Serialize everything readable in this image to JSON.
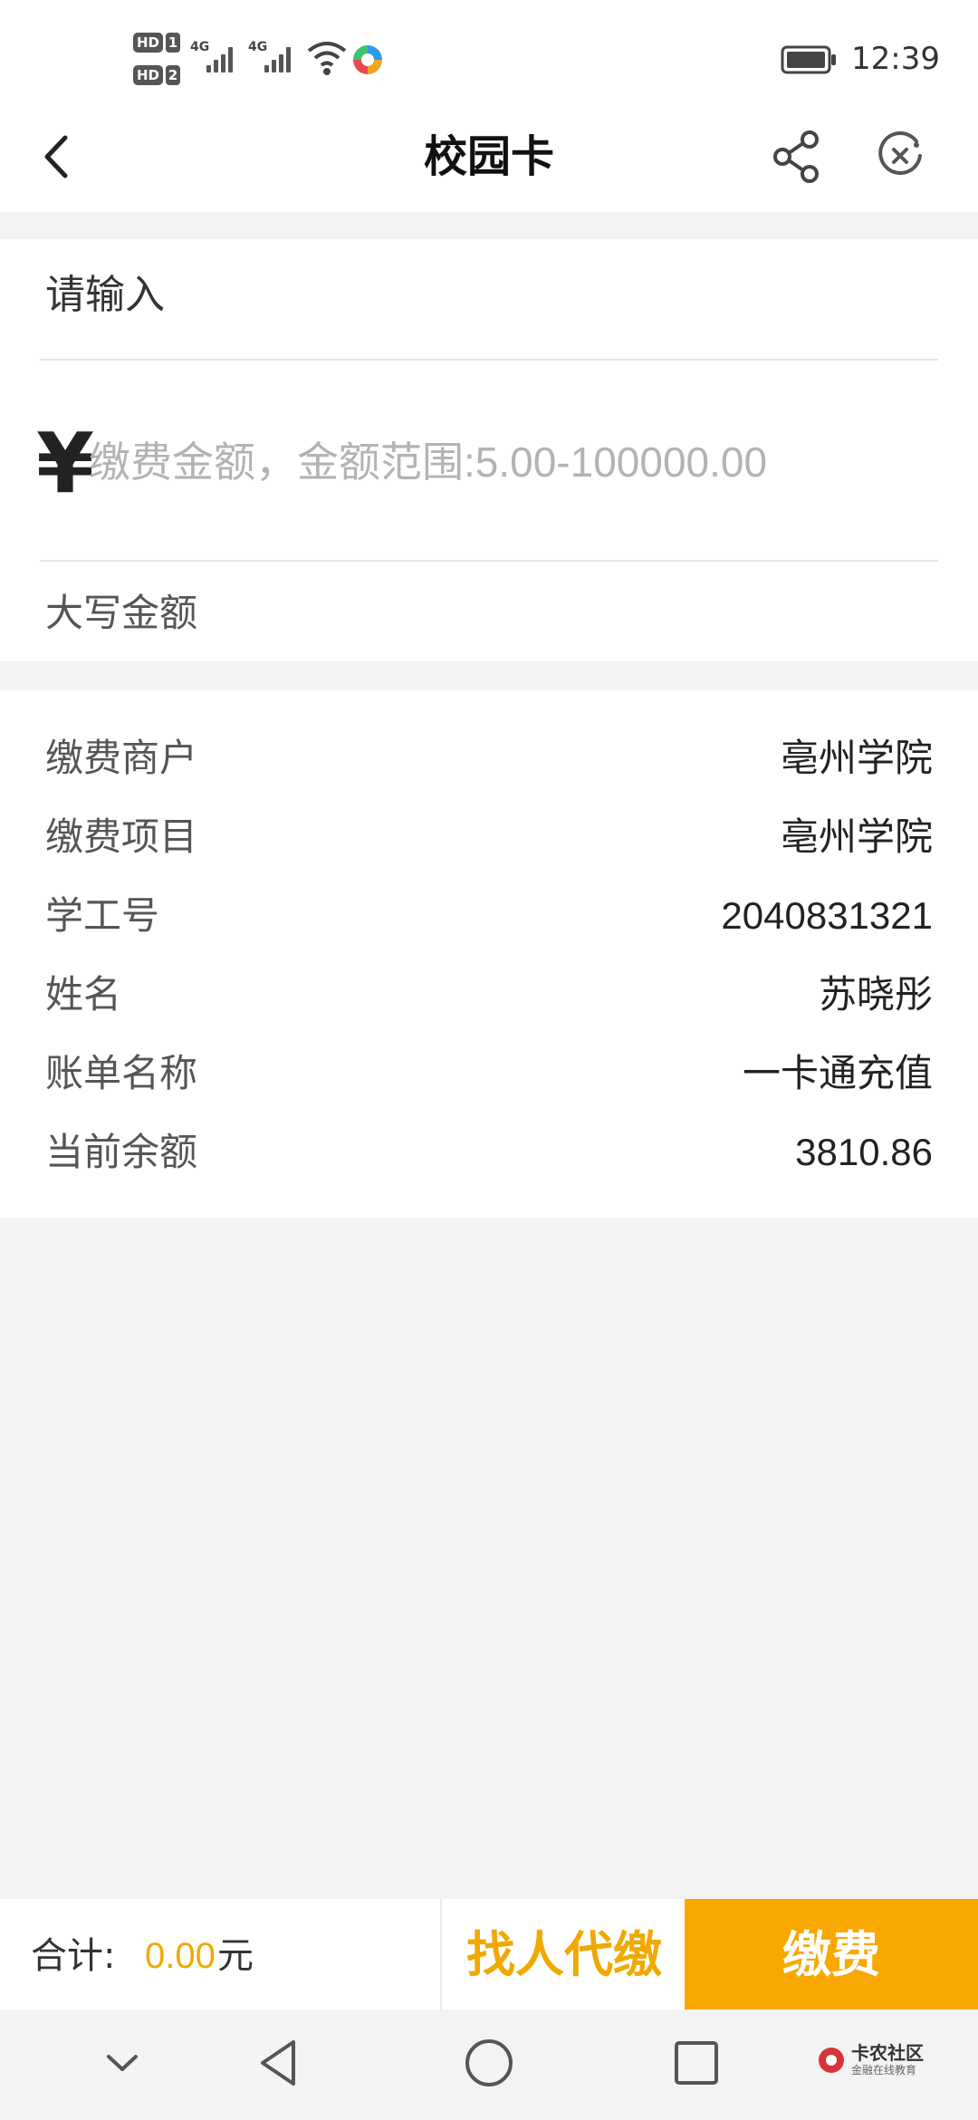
{
  "status_bar": {
    "hd1": "HD",
    "hd1_num": "1",
    "hd2": "HD",
    "hd2_num": "2",
    "net1": "4G",
    "net2": "4G",
    "time": "12:39"
  },
  "nav": {
    "title": "校园卡"
  },
  "input": {
    "label": "请输入",
    "currency_symbol": "¥",
    "amount_placeholder": "缴费金额，金额范围:5.00-100000.00",
    "amount_value": "",
    "upper_amount_label": "大写金额"
  },
  "info": {
    "rows": [
      {
        "label": "缴费商户",
        "value": "亳州学院"
      },
      {
        "label": "缴费项目",
        "value": "亳州学院"
      },
      {
        "label": "学工号",
        "value": "2040831321"
      },
      {
        "label": "姓名",
        "value": "苏晓彤"
      },
      {
        "label": "账单名称",
        "value": "一卡通充值"
      },
      {
        "label": "当前余额",
        "value": "3810.86"
      }
    ]
  },
  "bottom": {
    "total_label": "合计:",
    "total_value": "0.00",
    "total_unit": "元",
    "proxy_button": "找人代缴",
    "pay_button": "缴费"
  },
  "watermark": {
    "title": "卡农社区",
    "subtitle": "金融在线教育"
  },
  "colors": {
    "accent": "#f9a800",
    "accent_text": "#f0a900",
    "background": "#f3f3f3",
    "card": "#ffffff"
  },
  "icons": {
    "back": "back-arrow-icon",
    "share": "share-icon",
    "close": "close-mini-program-icon",
    "wifi": "wifi-icon",
    "battery": "battery-icon",
    "sys_down": "chevron-down-icon",
    "sys_back": "triangle-back-icon",
    "sys_home": "circle-home-icon",
    "sys_recent": "square-recent-icon"
  }
}
